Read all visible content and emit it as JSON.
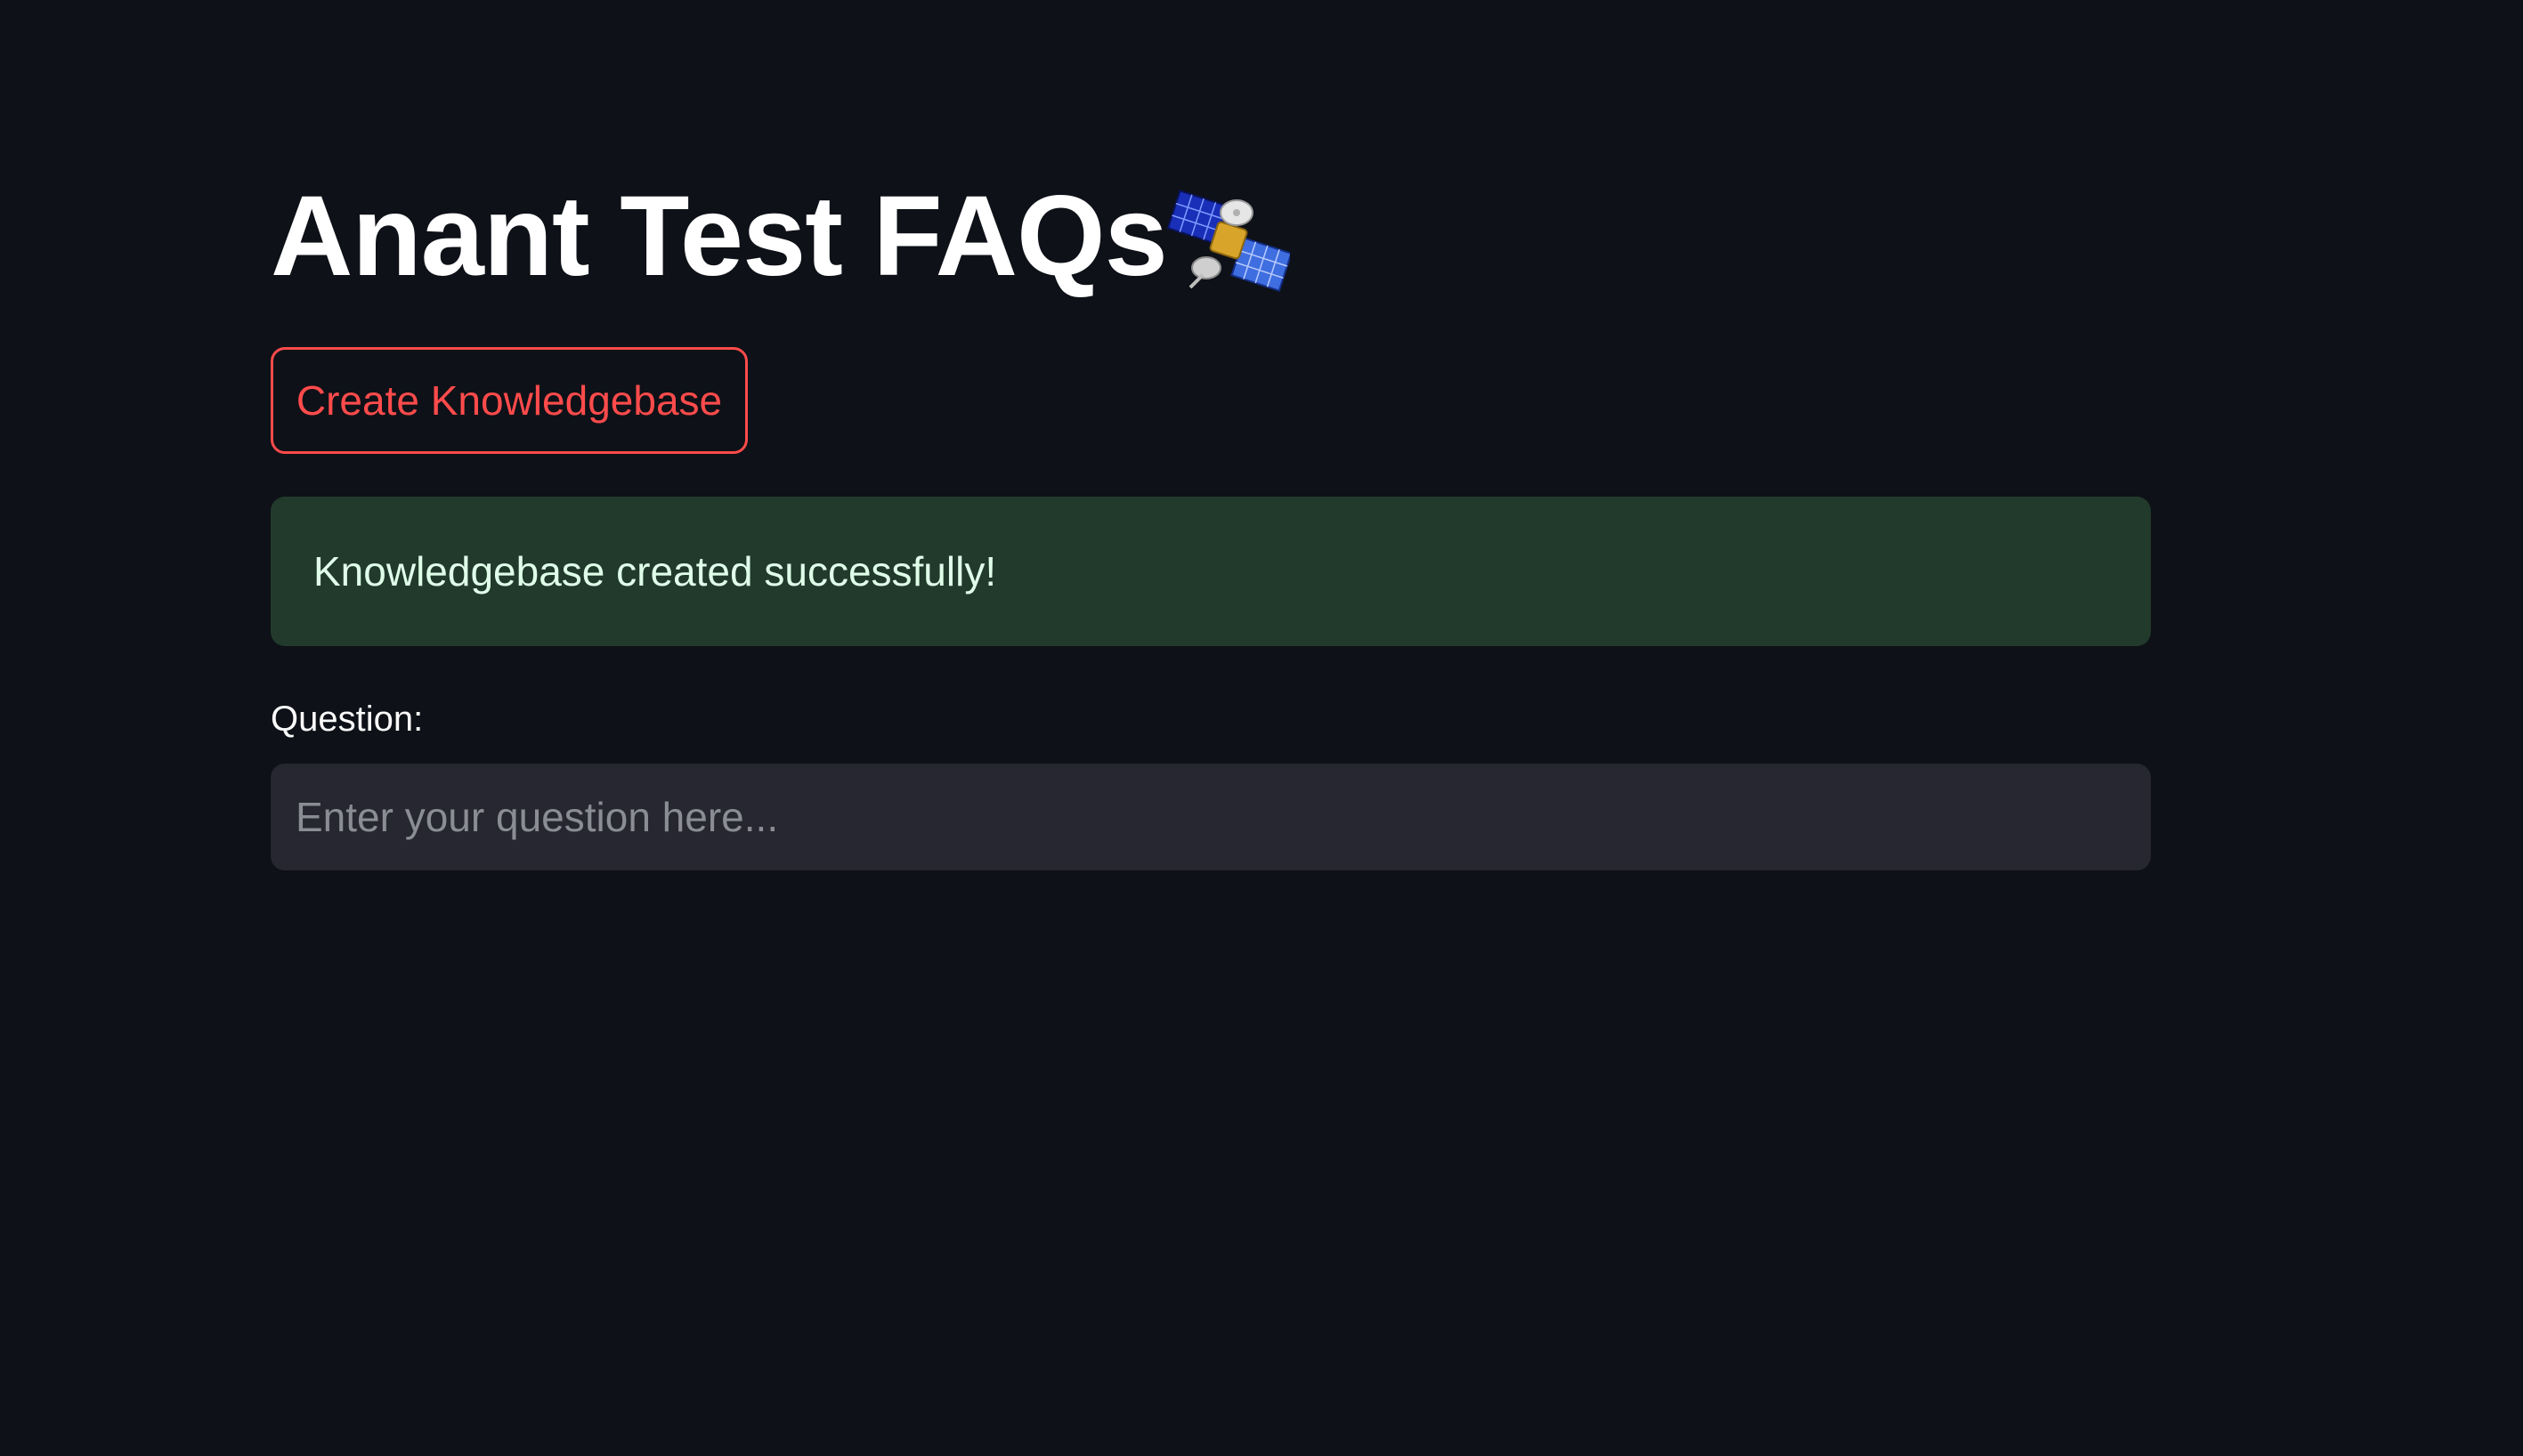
{
  "header": {
    "title": "Anant Test FAQs",
    "title_icon": "satellite-icon"
  },
  "actions": {
    "create_kb_label": "Create Knowledgebase"
  },
  "alert": {
    "message": "Knowledgebase created successfully!",
    "type": "success"
  },
  "question": {
    "label": "Question:",
    "value": "",
    "placeholder": "Enter your question here..."
  },
  "colors": {
    "background": "#0e1117",
    "accent": "#ff4b4b",
    "success_bg": "#213a2b",
    "success_text": "#dffde9",
    "input_bg": "#262730",
    "text": "#ffffff"
  }
}
